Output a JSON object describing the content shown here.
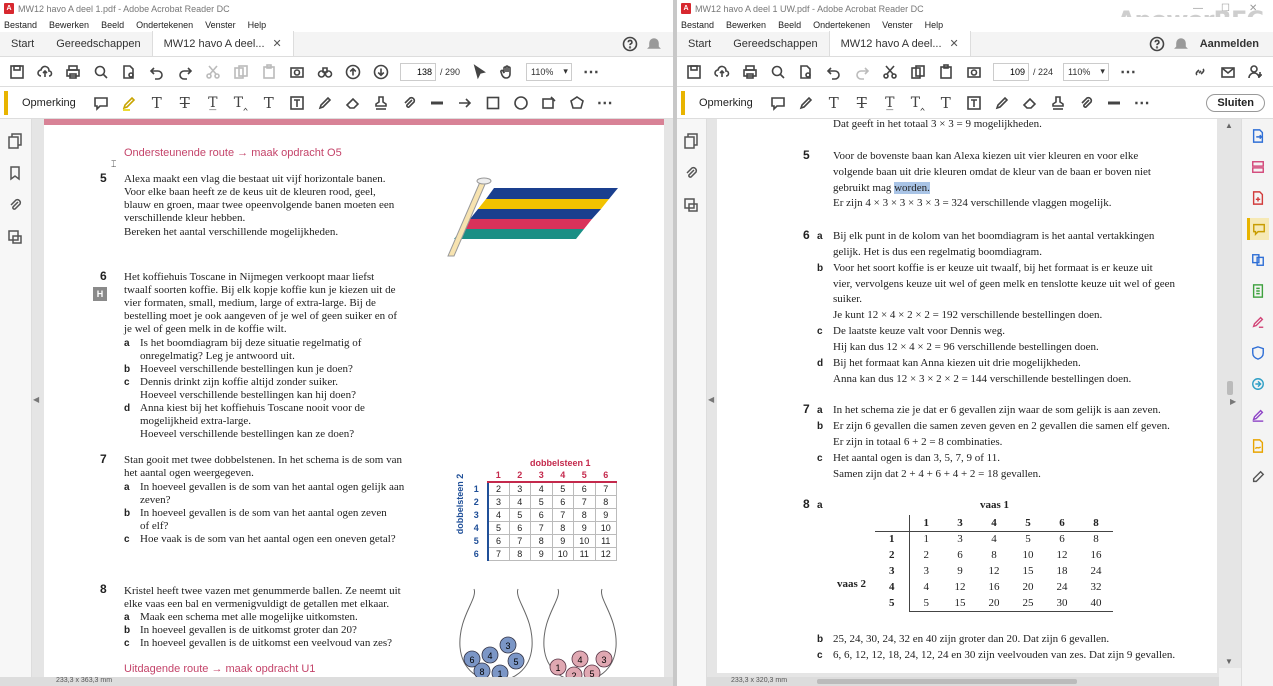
{
  "left": {
    "title": "MW12 havo A deel 1.pdf - Adobe Acrobat Reader DC",
    "menu": [
      "Bestand",
      "Bewerken",
      "Beeld",
      "Ondertekenen",
      "Venster",
      "Help"
    ],
    "tabs": {
      "start": "Start",
      "tools": "Gereedschappen",
      "doc": "MW12 havo A deel..."
    },
    "page_current": "138",
    "page_total": "/ 290",
    "zoom": "110%",
    "comment_label": "Opmerking",
    "status": "233,3 x 363,3 mm",
    "content": {
      "route1": "Ondersteunende route → maak opdracht O5",
      "q5_num": "5",
      "q5_lines": [
        "Alexa maakt een vlag die bestaat uit vijf horizontale banen.",
        "Voor elke baan heeft ze de keus uit de kleuren rood, geel,",
        "blauw en groen, maar twee opeenvolgende banen moeten een",
        "verschillende kleur hebben.",
        "Bereken het aantal verschillende mogelijkheden."
      ],
      "q6_num": "6",
      "h_badge": "H",
      "q6_lines": [
        "Het koffiehuis Toscane in Nijmegen verkoopt maar liefst",
        "twaalf soorten koffie. Bij elk kopje koffie kun je kiezen uit de",
        "vier formaten, small, medium, large of extra-large. Bij de",
        "bestelling moet je ook aangeven of je wel of geen suiker en of",
        "je wel of geen melk in de koffie wilt."
      ],
      "q6a": [
        "Is het boomdiagram bij deze situatie regelmatig of",
        "onregelmatig? Leg je antwoord uit."
      ],
      "q6b": [
        "Hoeveel verschillende bestellingen kun je doen?"
      ],
      "q6c": [
        "Dennis drinkt zijn koffie altijd zonder suiker.",
        "Hoeveel verschillende bestellingen kan hij doen?"
      ],
      "q6d": [
        "Anna kiest bij het koffiehuis Toscane nooit voor de",
        "mogelijkheid extra-large.",
        "Hoeveel verschillende bestellingen kan ze doen?"
      ],
      "q7_num": "7",
      "q7_lines": [
        "Stan gooit met twee dobbelstenen. In het schema is de som van",
        "het aantal ogen weergegeven."
      ],
      "q7a": [
        "In hoeveel gevallen is de som van het aantal ogen gelijk aan",
        "zeven?"
      ],
      "q7b": [
        "In hoeveel gevallen is de som van het aantal ogen zeven",
        "of elf?"
      ],
      "q7c": [
        "Hoe vaak is de som van het aantal ogen een oneven getal?"
      ],
      "dice_title1": "dobbelsteen 1",
      "dice_title2": "dobbelsteen 2",
      "dice_header": [
        "1",
        "2",
        "3",
        "4",
        "5",
        "6"
      ],
      "dice_rows": [
        [
          "1",
          "2",
          "3",
          "4",
          "5",
          "6",
          "7"
        ],
        [
          "2",
          "3",
          "4",
          "5",
          "6",
          "7",
          "8"
        ],
        [
          "3",
          "4",
          "5",
          "6",
          "7",
          "8",
          "9"
        ],
        [
          "4",
          "5",
          "6",
          "7",
          "8",
          "9",
          "10"
        ],
        [
          "5",
          "6",
          "7",
          "8",
          "9",
          "10",
          "11"
        ],
        [
          "6",
          "7",
          "8",
          "9",
          "10",
          "11",
          "12"
        ]
      ],
      "q8_num": "8",
      "q8_lines": [
        "Kristel heeft twee vazen met genummerde ballen. Ze neemt uit",
        "elke vaas een bal en vermenigvuldigt de getallen met elkaar."
      ],
      "q8a": "Maak een schema met alle mogelijke uitkomsten.",
      "q8b": "In hoeveel gevallen is de uitkomst groter dan 20?",
      "q8c": "In hoeveel gevallen is de uitkomst een veelvoud van zes?",
      "route2": "Uitdagende route → maak opdracht U1",
      "vase1_balls": [
        "6",
        "4",
        "3",
        "5",
        "8",
        "1"
      ],
      "vase2_balls": [
        "4",
        "3",
        "1",
        "2",
        "5"
      ]
    }
  },
  "right": {
    "title": "MW12 havo A deel 1 UW.pdf - Adobe Acrobat Reader DC",
    "menu": [
      "Bestand",
      "Bewerken",
      "Beeld",
      "Ondertekenen",
      "Venster",
      "Help"
    ],
    "tabs": {
      "start": "Start",
      "tools": "Gereedschappen",
      "doc": "MW12 havo A deel..."
    },
    "signin": "Aanmelden",
    "page_current": "109",
    "page_total": "/ 224",
    "zoom": "110%",
    "comment_label": "Opmerking",
    "close_label": "Sluiten",
    "status": "233,3 x 320,3 mm",
    "content": {
      "line0": "Dat geeft in het totaal 3 × 3 = 9 mogelijkheden.",
      "a5_num": "5",
      "a5_lines": [
        "Voor de bovenste baan kan Alexa kiezen uit vier kleuren en voor elke",
        "volgende baan uit drie kleuren omdat de kleur van de baan er boven niet"
      ],
      "a5_l3a": "gebruikt mag ",
      "a5_l3b": "worden.",
      "a5_l4": "Er zijn 4 × 3 × 3 × 3 × 3 = 324 verschillende vlaggen mogelijk.",
      "a6_num": "6",
      "a6a": [
        "Bij elk punt in de kolom van het boomdiagram is het aantal vertakkingen",
        "gelijk. Het is dus een regelmatig boomdiagram."
      ],
      "a6b": [
        "Voor het soort koffie is er keuze uit twaalf, bij het formaat is er keuze uit",
        "vier, vervolgens keuze uit wel of geen melk en tenslotte keuze uit wel of geen",
        "suiker.",
        "Je kunt 12 × 4 × 2 × 2 = 192 verschillende bestellingen doen."
      ],
      "a6c": [
        "De laatste keuze valt voor Dennis weg.",
        "Hij kan dus 12 × 4 × 2 = 96 verschillende bestellingen doen."
      ],
      "a6d": [
        "Bij het formaat kan Anna kiezen uit drie mogelijkheden.",
        "Anna kan dus 12 × 3 × 2 × 2 = 144 verschillende bestellingen doen."
      ],
      "a7_num": "7",
      "a7a": [
        "In het schema zie je dat er 6 gevallen zijn waar de som gelijk is aan zeven."
      ],
      "a7b": [
        "Er zijn 6 gevallen die samen zeven geven en 2 gevallen die samen elf geven.",
        "Er zijn in totaal 6 + 2 = 8 combinaties."
      ],
      "a7c": [
        "Het aantal ogen is dan 3, 5, 7, 9 of 11.",
        "Samen zijn dat 2 + 4 + 6 + 4 + 2 = 18 gevallen."
      ],
      "a8_num": "8",
      "vaas1": "vaas 1",
      "vaas2": "vaas 2",
      "vaas_header": [
        "1",
        "3",
        "4",
        "5",
        "6",
        "8"
      ],
      "vaas_rows": [
        [
          "1",
          "1",
          "3",
          "4",
          "5",
          "6",
          "8"
        ],
        [
          "2",
          "2",
          "6",
          "8",
          "10",
          "12",
          "16"
        ],
        [
          "3",
          "3",
          "9",
          "12",
          "15",
          "18",
          "24"
        ],
        [
          "4",
          "4",
          "12",
          "16",
          "20",
          "24",
          "32"
        ],
        [
          "5",
          "5",
          "15",
          "20",
          "25",
          "30",
          "40"
        ]
      ],
      "a8b": "25, 24, 30, 24, 32 en 40 zijn groter dan 20. Dat zijn 6 gevallen.",
      "a8c": "6, 6, 12, 12, 18, 24, 12, 24 en 30 zijn veelvouden van zes. Dat zijn 9 gevallen."
    }
  },
  "labels": {
    "a": "a",
    "b": "b",
    "c": "c",
    "d": "d"
  },
  "watermark": "ApowerREC"
}
